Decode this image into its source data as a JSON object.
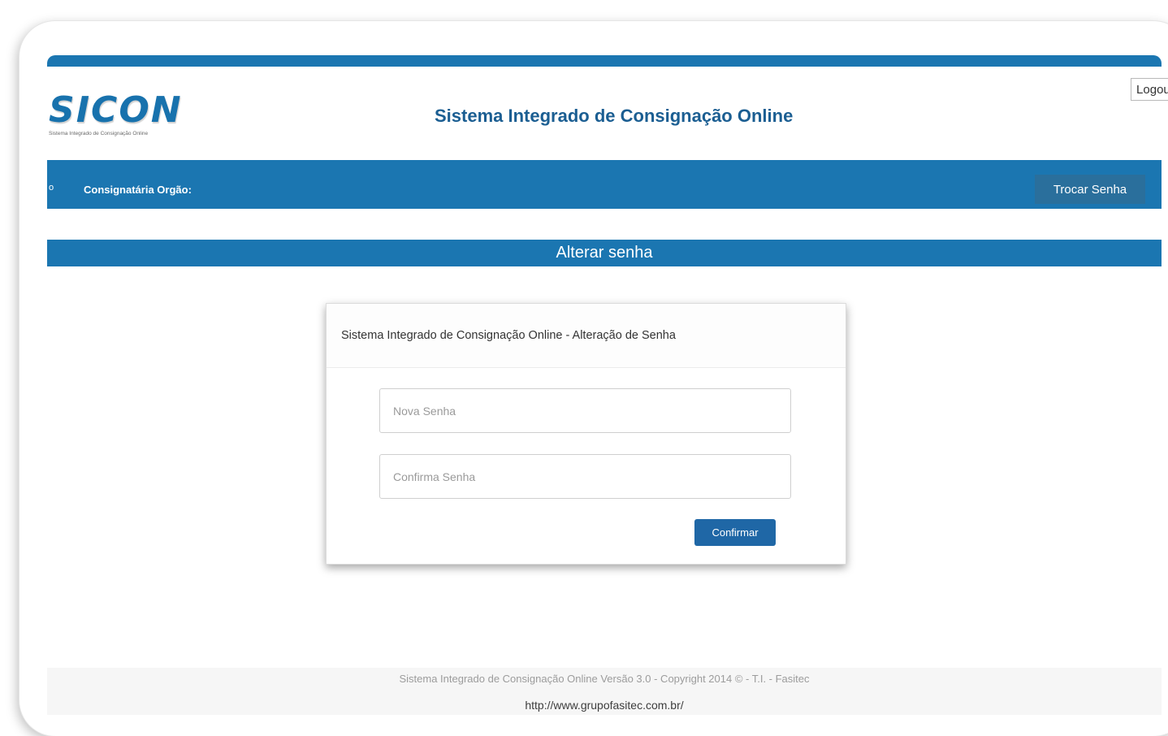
{
  "header": {
    "login_label": "Logout",
    "logo_text": "SICON",
    "logo_subtitle": "Sistema Integrado de Consignação Online",
    "app_title": "Sistema Integrado de Consignação Online"
  },
  "nav": {
    "dot_label": "o",
    "consignataria_label": "Consignatária Orgão:",
    "change_password_label": "Trocar Senha"
  },
  "section": {
    "title": "Alterar senha"
  },
  "form": {
    "card_title": "Sistema Integrado de Consignação Online - Alteração de Senha",
    "new_password_placeholder": "Nova Senha",
    "confirm_password_placeholder": "Confirma Senha",
    "confirm_button": "Confirmar"
  },
  "footer": {
    "text": "Sistema Integrado de Consignação Online Versão 3.0 - Copyright 2014 © - T.I. - Fasitec",
    "link": "http://www.grupofasitec.com.br/"
  },
  "colors": {
    "primary": "#1b76b1",
    "button_dark": "#2a6f9c",
    "confirm_button": "#1f67a6",
    "title_text": "#1b5e92"
  }
}
